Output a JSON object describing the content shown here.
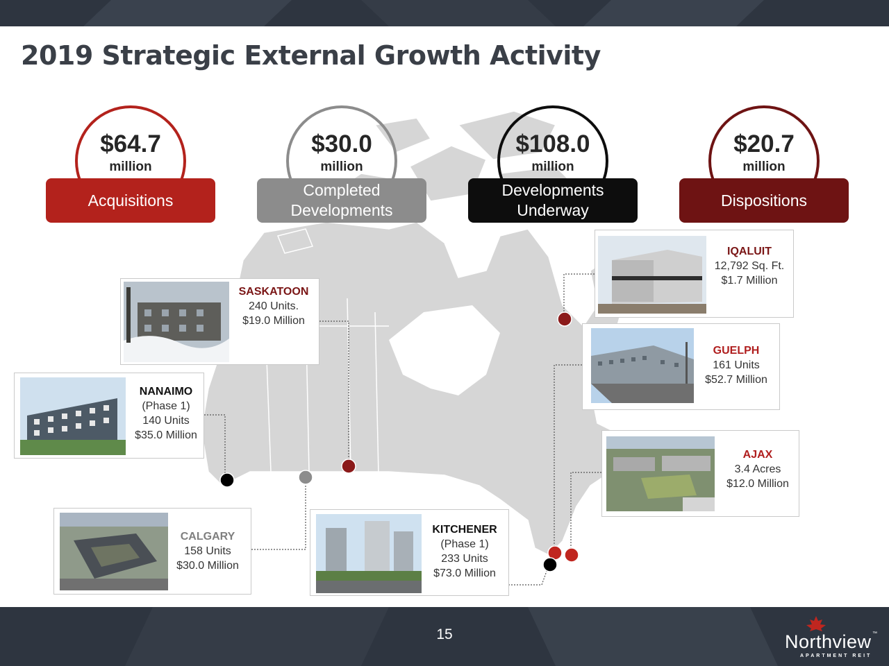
{
  "page": {
    "title": "2019 Strategic External Growth Activity",
    "page_number": "15"
  },
  "metrics": [
    {
      "amount": "$64.7",
      "unit": "million",
      "label_lines": [
        "Acquisitions"
      ],
      "color": "#b3221c"
    },
    {
      "amount": "$30.0",
      "unit": "million",
      "label_lines": [
        "Completed",
        "Developments"
      ],
      "color": "#8c8c8c"
    },
    {
      "amount": "$108.0",
      "unit": "million",
      "label_lines": [
        "Developments",
        "Underway"
      ],
      "color": "#0d0d0d"
    },
    {
      "amount": "$20.7",
      "unit": "million",
      "label_lines": [
        "Dispositions"
      ],
      "color": "#6e1313"
    }
  ],
  "properties": {
    "saskatoon": {
      "city": "SASKATOON",
      "line1": "240 Units.",
      "line2": "$19.0 Million",
      "marker_color": "#8b1a1a"
    },
    "nanaimo": {
      "city": "NANAIMO",
      "line1": "(Phase 1)",
      "line2": "140 Units",
      "line3": "$35.0 Million",
      "marker_color": "#000000"
    },
    "calgary": {
      "city": "CALGARY",
      "line1": "158 Units",
      "line2": "$30.0 Million",
      "marker_color": "#8c8c8c"
    },
    "kitchener": {
      "city": "KITCHENER",
      "line1": "(Phase 1)",
      "line2": "233 Units",
      "line3": "$73.0 Million",
      "marker_color": "#000000"
    },
    "iqaluit": {
      "city": "IQALUIT",
      "line1": "12,792 Sq. Ft.",
      "line2": "$1.7 Million",
      "marker_color": "#8b1a1a"
    },
    "guelph": {
      "city": "GUELPH",
      "line1": "161 Units",
      "line2": "$52.7 Million",
      "marker_color": "#c0261f"
    },
    "ajax": {
      "city": "AJAX",
      "line1": "3.4 Acres",
      "line2": "$12.0 Million",
      "marker_color": "#c0261f"
    }
  },
  "logo": {
    "name": "Northview",
    "tm": "™",
    "tagline": "APARTMENT REIT",
    "leaf_color": "#c0261f"
  }
}
